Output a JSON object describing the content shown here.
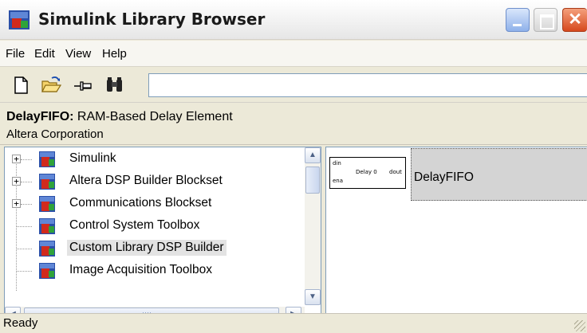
{
  "window": {
    "title": "Simulink Library Browser"
  },
  "menu": {
    "items": [
      "File",
      "Edit",
      "View",
      "Help"
    ]
  },
  "toolbar": {
    "icons": [
      "new-document-icon",
      "open-folder-icon",
      "pin-icon",
      "find-binoculars-icon"
    ],
    "search_value": ""
  },
  "info": {
    "block_name": "DelayFIFO:",
    "block_desc": "RAM-Based Delay Element",
    "vendor": "Altera Corporation"
  },
  "tree": {
    "items": [
      {
        "label": "Simulink",
        "expandable": true
      },
      {
        "label": "Altera DSP Builder Blockset",
        "expandable": true
      },
      {
        "label": "Communications Blockset",
        "expandable": true
      },
      {
        "label": "Control System Toolbox",
        "expandable": false
      },
      {
        "label": "Custom Library DSP Builder",
        "expandable": false,
        "selected": true
      },
      {
        "label": "Image Acquisition Toolbox",
        "expandable": false
      }
    ]
  },
  "block": {
    "name": "DelayFIFO",
    "ports": {
      "in1": "din",
      "in2": "ena",
      "center": "Delay 0",
      "out": "dout"
    }
  },
  "status": {
    "text": "Ready"
  },
  "colors": {
    "selection": "#e3e3e3",
    "block_highlight": "#d4d4d4",
    "close_button": "#d6481d"
  }
}
